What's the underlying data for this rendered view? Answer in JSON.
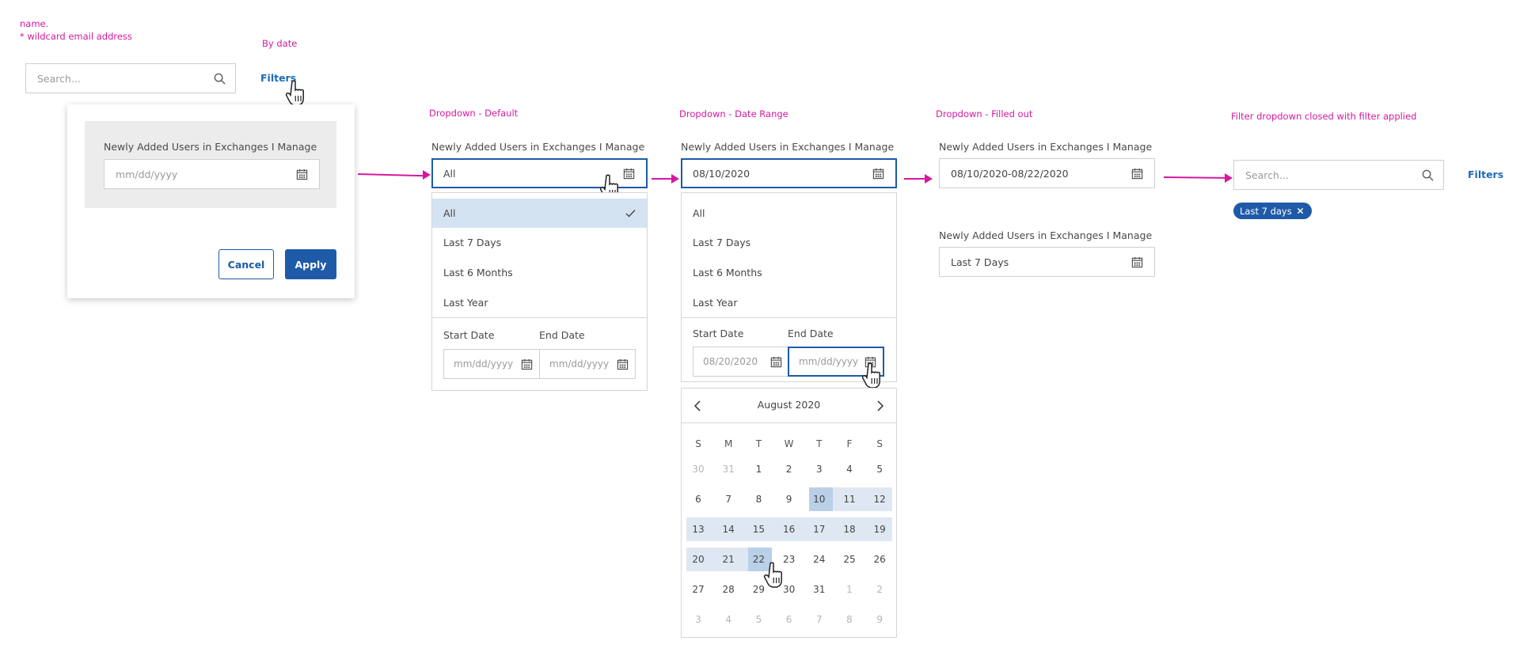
{
  "notes": {
    "top_left_line1": "name.",
    "top_left_line2": "* wildcard email address",
    "by_date": "By date",
    "dropdown_default": "Dropdown - Default",
    "dropdown_date_range": "Dropdown - Date Range",
    "dropdown_filled": "Dropdown - Filled out",
    "filter_closed": "Filter dropdown closed with filter applied"
  },
  "search": {
    "placeholder": "Search..."
  },
  "filters_link": "Filters",
  "panel": {
    "field_label": "Newly Added Users in Exchanges I Manage",
    "date_placeholder": "mm/dd/yyyy",
    "cancel": "Cancel",
    "apply": "Apply"
  },
  "default_dropdown": {
    "label": "Newly Added Users in Exchanges I Manage",
    "value": "All",
    "options": [
      "All",
      "Last 7 Days",
      "Last 6 Months",
      "Last Year"
    ],
    "start_label": "Start Date",
    "end_label": "End Date",
    "start_placeholder": "mm/dd/yyyy",
    "end_placeholder": "mm/dd/yyyy"
  },
  "range_dropdown": {
    "label": "Newly Added Users in Exchanges I Manage",
    "value": "08/10/2020",
    "options": [
      "All",
      "Last 7 Days",
      "Last 6 Months",
      "Last Year"
    ],
    "start_label": "Start Date",
    "end_label": "End Date",
    "start_value": "08/20/2020",
    "end_placeholder": "mm/dd/yyyy"
  },
  "calendar": {
    "month": "August 2020",
    "weekdays": [
      "S",
      "M",
      "T",
      "W",
      "T",
      "F",
      "S"
    ],
    "weeks": [
      [
        "30",
        "31",
        "1",
        "2",
        "3",
        "4",
        "5"
      ],
      [
        "6",
        "7",
        "8",
        "9",
        "10",
        "11",
        "12"
      ],
      [
        "13",
        "14",
        "15",
        "16",
        "17",
        "18",
        "19"
      ],
      [
        "20",
        "21",
        "22",
        "23",
        "24",
        "25",
        "26"
      ],
      [
        "27",
        "28",
        "29",
        "30",
        "31",
        "1",
        "2"
      ],
      [
        "3",
        "4",
        "5",
        "6",
        "7",
        "8",
        "9"
      ]
    ],
    "range_start": "10",
    "range_end": "22"
  },
  "filled": {
    "label1": "Newly Added Users in Exchanges I Manage",
    "value1": "08/10/2020-08/22/2020",
    "label2": "Newly Added Users in Exchanges I Manage",
    "value2": "Last 7 Days"
  },
  "applied": {
    "search_placeholder": "Search...",
    "filters_link": "Filters",
    "chip": "Last 7 days"
  },
  "colors": {
    "accent": "#1e5aa8",
    "annotation": "#d4199f",
    "selected": "#d4e3f2"
  }
}
